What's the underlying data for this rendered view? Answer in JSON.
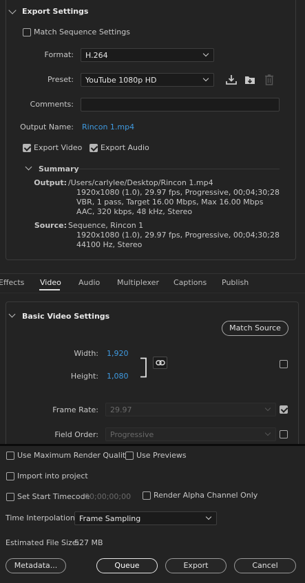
{
  "export_settings": {
    "title": "Export Settings",
    "match_sequence": {
      "label": "Match Sequence Settings",
      "checked": false
    },
    "format": {
      "label": "Format:",
      "value": "H.264"
    },
    "preset": {
      "label": "Preset:",
      "value": "YouTube 1080p HD"
    },
    "comments": {
      "label": "Comments:",
      "value": ""
    },
    "output_name": {
      "label": "Output Name:",
      "value": "Rincon 1.mp4"
    },
    "export_video": {
      "label": "Export Video",
      "checked": true
    },
    "export_audio": {
      "label": "Export Audio",
      "checked": true
    },
    "summary": {
      "title": "Summary",
      "output_label": "Output:",
      "output_lines": [
        "/Users/carlylee/Desktop/Rincon 1.mp4",
        "1920x1080 (1.0), 29.97 fps, Progressive, 00;04;30;28",
        "VBR, 1 pass, Target 16.00 Mbps, Max 16.00 Mbps",
        "AAC, 320 kbps, 48 kHz, Stereo"
      ],
      "source_label": "Source:",
      "source_lines": [
        "Sequence, Rincon 1",
        "1920x1080 (1.0), 29.97 fps, Progressive, 00;04;30;28",
        "44100 Hz, Stereo"
      ]
    }
  },
  "tabs": [
    {
      "label": "Effects",
      "active": false
    },
    {
      "label": "Video",
      "active": true
    },
    {
      "label": "Audio",
      "active": false
    },
    {
      "label": "Multiplexer",
      "active": false
    },
    {
      "label": "Captions",
      "active": false
    },
    {
      "label": "Publish",
      "active": false
    }
  ],
  "video": {
    "section_title": "Basic Video Settings",
    "match_source": "Match Source",
    "width": {
      "label": "Width:",
      "value": "1,920"
    },
    "height": {
      "label": "Height:",
      "value": "1,080"
    },
    "frame_rate": {
      "label": "Frame Rate:",
      "value": "29.97",
      "checked": true
    },
    "field_order": {
      "label": "Field Order:",
      "value": "Progressive",
      "checked": false
    }
  },
  "bottom": {
    "max_render_quality": {
      "label": "Use Maximum Render Quality",
      "checked": false
    },
    "use_previews": {
      "label": "Use Previews",
      "checked": false
    },
    "import_project": {
      "label": "Import into project",
      "checked": false
    },
    "start_timecode": {
      "label": "Set Start Timecode",
      "value": "00;00;00;00",
      "checked": false
    },
    "alpha_only": {
      "label": "Render Alpha Channel Only",
      "checked": false
    },
    "time_interpolation": {
      "label": "Time Interpolation:",
      "value": "Frame Sampling"
    },
    "file_size": {
      "label": "Estimated File Size:",
      "value": "527 MB"
    },
    "buttons": {
      "metadata": "Metadata...",
      "queue": "Queue",
      "export": "Export",
      "cancel": "Cancel"
    }
  },
  "colors": {
    "background": "#232323",
    "link_blue": "#3f9ae0",
    "text": "#c8c8c8"
  }
}
